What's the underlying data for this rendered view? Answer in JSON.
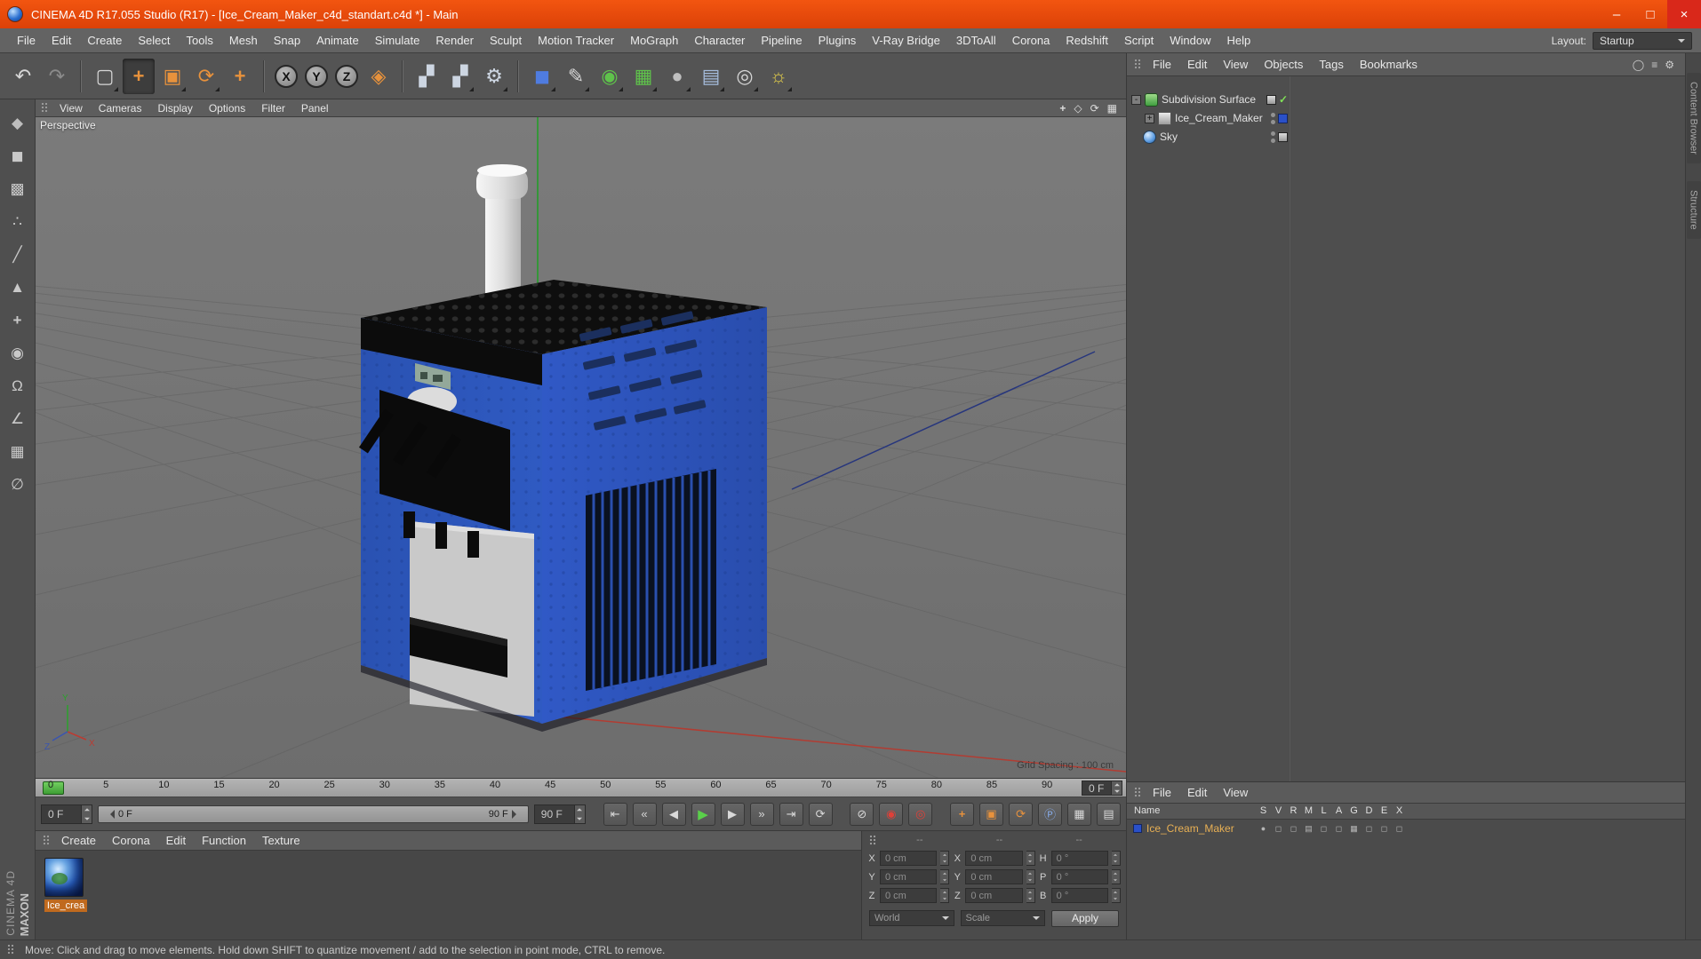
{
  "titlebar": {
    "title": "CINEMA 4D R17.055 Studio (R17) - [Ice_Cream_Maker_c4d_standart.c4d *] - Main",
    "minimize_glyph": "–",
    "maximize_glyph": "□",
    "close_glyph": "×"
  },
  "menubar": {
    "items": [
      "File",
      "Edit",
      "Create",
      "Select",
      "Tools",
      "Mesh",
      "Snap",
      "Animate",
      "Simulate",
      "Render",
      "Sculpt",
      "Motion Tracker",
      "MoGraph",
      "Character",
      "Pipeline",
      "Plugins",
      "V-Ray Bridge",
      "3DToAll",
      "Corona",
      "Redshift",
      "Script",
      "Window",
      "Help"
    ],
    "layout_label": "Layout:",
    "layout_value": "Startup"
  },
  "toolbar": {
    "undo": "↶",
    "redo": "↷",
    "live_selection": "▢",
    "move": "+",
    "scale": "▣",
    "rotate": "⟳",
    "last_tool": "+",
    "axis_x": "X",
    "axis_y": "Y",
    "axis_z": "Z",
    "coord_system": "◈",
    "render_view": "▞",
    "render_picture_viewer": "▞",
    "render_settings": "⚙",
    "add_cube": "◼",
    "spline_pen": "✎",
    "subdivision_surface": "◉",
    "mograph": "▦",
    "deformer": "●",
    "environment": "▤",
    "camera": "◎",
    "light": "☼"
  },
  "leftbar": {
    "icons": [
      {
        "name": "make-editable",
        "glyph": "◆"
      },
      {
        "name": "model-mode",
        "glyph": "◼"
      },
      {
        "name": "texture-mode",
        "glyph": "▩"
      },
      {
        "name": "points-mode",
        "glyph": "∴"
      },
      {
        "name": "edges-mode",
        "glyph": "╱"
      },
      {
        "name": "polygons-mode",
        "glyph": "▲"
      },
      {
        "name": "enable-axis",
        "glyph": "+"
      },
      {
        "name": "viewport-solo",
        "glyph": "◉"
      },
      {
        "name": "snap",
        "glyph": "Ω"
      },
      {
        "name": "quantize",
        "glyph": "∠"
      },
      {
        "name": "workplane",
        "glyph": "▦"
      },
      {
        "name": "lock-workplane",
        "glyph": "∅"
      }
    ]
  },
  "viewport": {
    "menu": [
      "View",
      "Cameras",
      "Display",
      "Options",
      "Filter",
      "Panel"
    ],
    "camera": "Perspective",
    "grid_spacing": "Grid Spacing : 100 cm",
    "nav": {
      "pan": "+",
      "zoom": "◇",
      "rotate": "⟳",
      "layout": "▦"
    },
    "axis_labels": {
      "x": "X",
      "y": "Y",
      "z": "Z"
    }
  },
  "object_manager": {
    "menu": [
      "File",
      "Edit",
      "View",
      "Objects",
      "Tags",
      "Bookmarks"
    ],
    "header_icons": [
      {
        "name": "search-icon",
        "glyph": "◯"
      },
      {
        "name": "filter-icon",
        "glyph": "≡"
      },
      {
        "name": "gear-icon",
        "glyph": "⚙"
      }
    ],
    "rows": [
      {
        "name": "Subdivision Surface",
        "expander": "-",
        "enabled_glyph": "✓"
      },
      {
        "name": "Ice_Cream_Maker",
        "expander": "+"
      },
      {
        "name": "Sky"
      }
    ]
  },
  "side_tabs": [
    "Content Browser",
    "Structure"
  ],
  "timeline": {
    "ticks": [
      "0",
      "5",
      "10",
      "15",
      "20",
      "25",
      "30",
      "35",
      "40",
      "45",
      "50",
      "55",
      "60",
      "65",
      "70",
      "75",
      "80",
      "85",
      "90"
    ],
    "ruler_frame": "0 F",
    "current_frame": "0 F",
    "range_start": "0 F",
    "range_end": "90 F",
    "end_frame": "90 F",
    "transport": {
      "goto_start": "⇤",
      "prev_key": "«",
      "prev_frame": "◀",
      "play": "▶",
      "next_frame": "▶",
      "next_key": "»",
      "goto_end": "⇥",
      "loop": "⟳",
      "no_solo": "⊘",
      "record": "◉",
      "autokey": "◎",
      "key_position": "+",
      "key_scale": "▣",
      "key_rotation": "⟳",
      "key_parameter": "Ⓟ",
      "key_pla": "▦",
      "show_fcurves": "▤"
    }
  },
  "materials": {
    "menu": [
      "Create",
      "Corona",
      "Edit",
      "Function",
      "Texture"
    ],
    "items": [
      {
        "name": "Ice_crea"
      }
    ]
  },
  "coordinates": {
    "headers": [
      "--",
      "--",
      "--"
    ],
    "rows": [
      {
        "l1": "X",
        "v1": "0 cm",
        "l2": "X",
        "v2": "0 cm",
        "l3": "H",
        "v3": "0 °"
      },
      {
        "l1": "Y",
        "v1": "0 cm",
        "l2": "Y",
        "v2": "0 cm",
        "l3": "P",
        "v3": "0 °"
      },
      {
        "l1": "Z",
        "v1": "0 cm",
        "l2": "Z",
        "v2": "0 cm",
        "l3": "B",
        "v3": "0 °"
      }
    ],
    "mode_left": "World",
    "mode_right": "Scale",
    "apply": "Apply"
  },
  "layers": {
    "menu": [
      "File",
      "Edit",
      "View"
    ],
    "name_header": "Name",
    "columns": [
      "S",
      "V",
      "R",
      "M",
      "L",
      "A",
      "G",
      "D",
      "E",
      "X"
    ],
    "rows": [
      {
        "name": "Ice_Cream_Maker",
        "color": "#2a50c8",
        "toggles": [
          "●",
          "◻",
          "◻",
          "▤",
          "◻",
          "◻",
          "▦",
          "◻",
          "◻",
          "◻"
        ]
      }
    ]
  },
  "status_bar": {
    "text": "Move: Click and drag to move elements. Hold down SHIFT to quantize movement / add to the selection in point mode, CTRL to remove."
  },
  "branding": {
    "line1": "MAXON",
    "line2": "CINEMA 4D"
  },
  "colors": {
    "titlebar_orange": "#ea4b10",
    "accent_orange": "#e8923c",
    "selection_blue": "#2a50c8",
    "play_green": "#4db345",
    "close_red": "#d9281a",
    "machine_blue": "#2c55b8"
  }
}
